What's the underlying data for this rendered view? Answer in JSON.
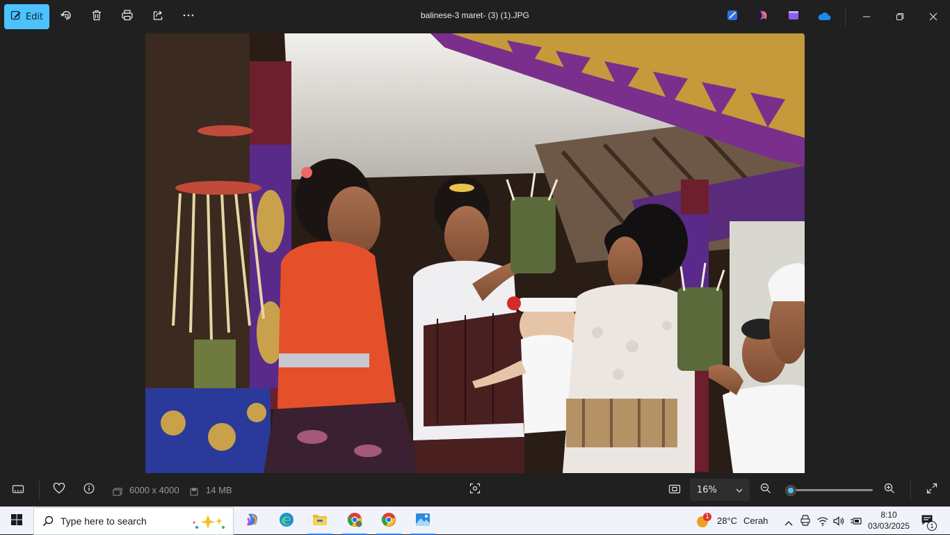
{
  "toolbar": {
    "edit_label": "Edit",
    "file_title": "balinese-3 maret- (3) (1).JPG"
  },
  "info": {
    "dimensions": "6000 x 4000",
    "file_size": "14 MB"
  },
  "zoom": {
    "level": "16%",
    "slider_fraction": 0.05
  },
  "taskbar": {
    "search_placeholder": "Type here to search",
    "weather_temp": "28°C",
    "weather_desc": "Cerah",
    "weather_badge": "1",
    "time": "8:10",
    "date": "03/03/2025",
    "notification_count": "1"
  },
  "colors": {
    "accent": "#4cc2ff",
    "background": "#202020",
    "taskbar": "#f0f3f9"
  }
}
